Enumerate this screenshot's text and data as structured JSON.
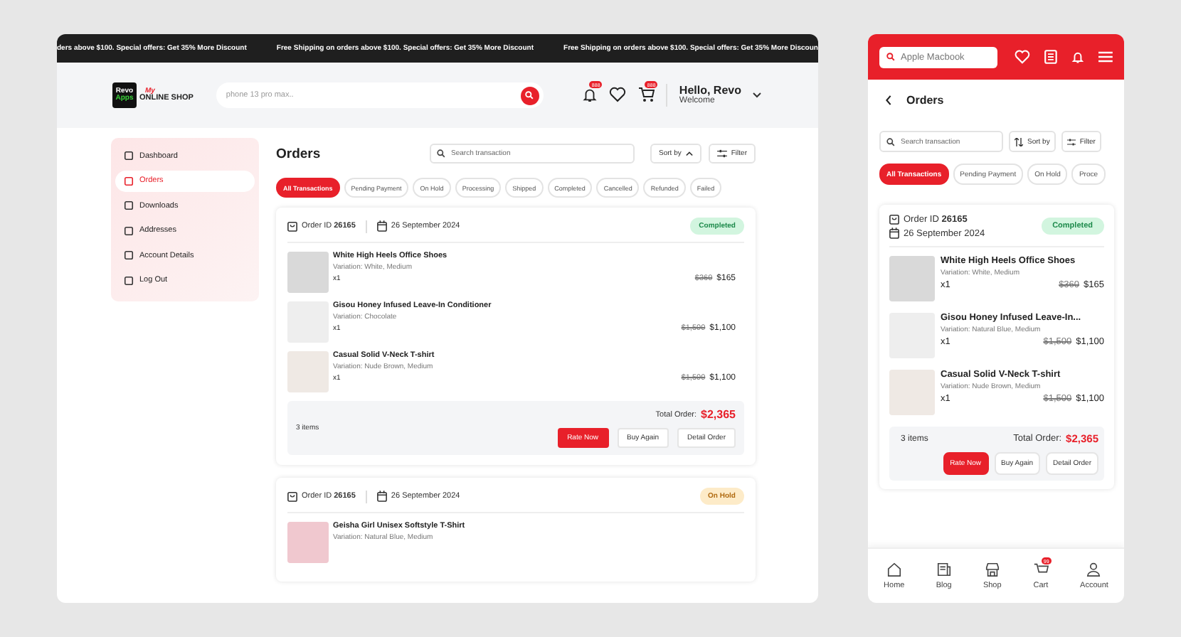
{
  "announcement": {
    "messages": [
      "ders above $100. Special offers: Get 35% More Discount",
      "Free Shipping on orders above $100. Special offers: Get 35% More Discount",
      "Free Shipping on orders above $100. Special offers: Get 35% More Discoun"
    ]
  },
  "header": {
    "logo": {
      "line_1": "Revo",
      "line_2": "Apps",
      "script": "My",
      "wordmark": "ONLINE SHOP"
    },
    "search": {
      "value": "phone 13 pro max.."
    },
    "notification_badge": "888",
    "cart_badge": "888",
    "greeting": "Hello, Revo",
    "subtitle": "Welcome"
  },
  "sidebar": {
    "items": [
      {
        "label": "Dashboard",
        "selected": false
      },
      {
        "label": "Orders",
        "selected": true
      },
      {
        "label": "Downloads",
        "selected": false
      },
      {
        "label": "Addresses",
        "selected": false
      },
      {
        "label": "Account Details",
        "selected": false
      },
      {
        "label": "Log Out",
        "selected": false
      }
    ]
  },
  "orders_page": {
    "title": "Orders",
    "search": {
      "placeholder": "Search transaction"
    },
    "sort": "Sort by",
    "filter": "Filter",
    "status_filters": [
      {
        "label": "All Transactions",
        "selected": true
      },
      {
        "label": "Pending Payment",
        "selected": false
      },
      {
        "label": "On Hold",
        "selected": false
      },
      {
        "label": "Processing",
        "selected": false
      },
      {
        "label": "Shipped",
        "selected": false
      },
      {
        "label": "Completed",
        "selected": false
      },
      {
        "label": "Cancelled",
        "selected": false
      },
      {
        "label": "Refunded",
        "selected": false
      },
      {
        "label": "Failed",
        "selected": false
      }
    ],
    "orders": [
      {
        "id_label": "Order ID",
        "id": "26165",
        "date": "26 September 2024",
        "status": {
          "kind": "completed",
          "label": "Completed"
        },
        "items": [
          {
            "name": "White High Heels Office Shoes",
            "variation": "Variation: White, Medium",
            "qty": "x1",
            "old_price": "$360",
            "price": "$165"
          },
          {
            "name": "Gisou Honey Infused Leave-In Conditioner",
            "variation": "Variation: Chocolate",
            "qty": "x1",
            "old_price": "$1,500",
            "price": "$1,100"
          },
          {
            "name": "Casual Solid V-Neck T-shirt",
            "variation": "Variation: Nude Brown, Medium",
            "qty": "x1",
            "old_price": "$1,500",
            "price": "$1,100"
          }
        ],
        "footer": {
          "count": "3 items",
          "total_label": "Total Order:",
          "total": "$2,365",
          "buttons": [
            {
              "label": "Rate Now",
              "kind": "primary"
            },
            {
              "label": "Buy Again",
              "kind": "outline"
            },
            {
              "label": "Detail Order",
              "kind": "outline"
            }
          ]
        }
      },
      {
        "id_label": "Order ID",
        "id": "26165",
        "date": "26 September 2024",
        "status": {
          "kind": "on_hold",
          "label": "On Hold"
        },
        "items": [
          {
            "name": "Geisha Girl Unisex Softstyle T-Shirt",
            "variation": "Variation: Natural Blue, Medium"
          }
        ]
      }
    ]
  },
  "mobile": {
    "search": {
      "placeholder": "Apple Macbook"
    },
    "title": "Orders",
    "search_transactions": {
      "placeholder": "Search transaction"
    },
    "sort": "Sort by",
    "filter": "Filter",
    "status_filters": [
      {
        "label": "All Transactions",
        "selected": true
      },
      {
        "label": "Pending Payment",
        "selected": false
      },
      {
        "label": "On Hold",
        "selected": false
      },
      {
        "label": "Proce",
        "selected": false
      }
    ],
    "order": {
      "id_label": "Order ID",
      "id": "26165",
      "date": "26 September 2024",
      "status": {
        "kind": "completed",
        "label": "Completed"
      },
      "items": [
        {
          "name": "White High Heels Office Shoes",
          "variation": "Variation: White, Medium",
          "qty": "x1",
          "old_price": "$360",
          "price": "$165"
        },
        {
          "name": "Gisou Honey Infused Leave-In...",
          "variation": "Variation: Natural Blue, Medium",
          "qty": "x1",
          "old_price": "$1,500",
          "price": "$1,100"
        },
        {
          "name": "Casual Solid V-Neck T-shirt",
          "variation": "Variation: Nude Brown, Medium",
          "qty": "x1",
          "old_price": "$1,500",
          "price": "$1,100"
        }
      ],
      "footer": {
        "count": "3 items",
        "total_label": "Total Order:",
        "total": "$2,365",
        "buttons": [
          {
            "label": "Rate Now",
            "kind": "primary"
          },
          {
            "label": "Buy Again",
            "kind": "outline"
          },
          {
            "label": "Detail Order",
            "kind": "outline"
          }
        ]
      }
    },
    "bottom_nav": [
      {
        "label": "Home",
        "selected": false
      },
      {
        "label": "Blog",
        "selected": false
      },
      {
        "label": "Shop",
        "selected": false
      },
      {
        "label": "Cart",
        "selected": false,
        "badge": "99"
      },
      {
        "label": "Account",
        "selected": false
      }
    ]
  }
}
